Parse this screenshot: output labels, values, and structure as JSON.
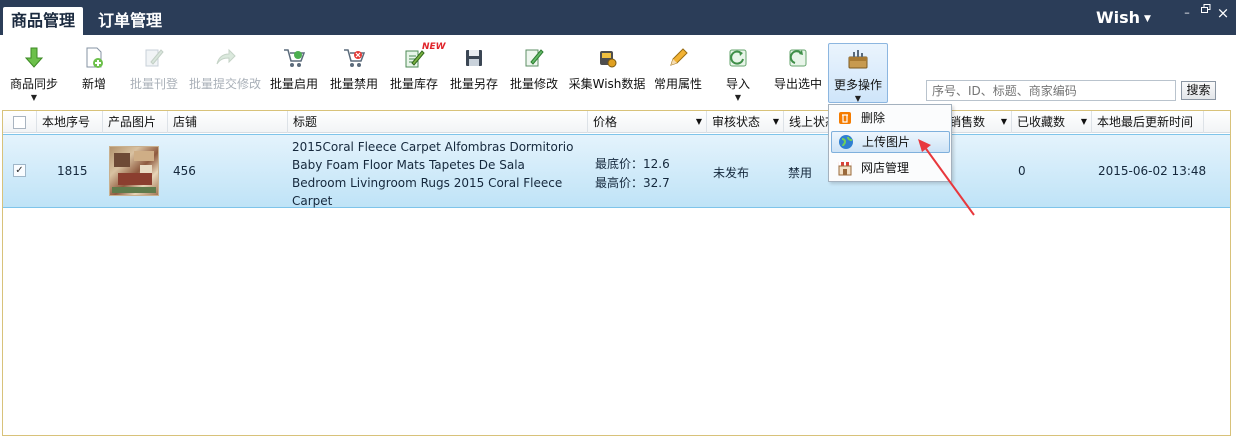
{
  "tabs": [
    {
      "label": "商品管理",
      "active": true
    },
    {
      "label": "订单管理",
      "active": false
    }
  ],
  "account": {
    "label": "Wish"
  },
  "window_controls": {
    "minimize": "–",
    "restore": "ᵖ",
    "close": "×"
  },
  "toolbar": {
    "buttons": [
      {
        "label": "商品同步",
        "icon": "sync-down-arrow-icon",
        "dropdown": true,
        "enabled": true
      },
      {
        "label": "新增",
        "icon": "new-document-icon",
        "enabled": true
      },
      {
        "label": "批量刊登",
        "icon": "publish-icon",
        "enabled": false
      },
      {
        "label": "批量提交修改",
        "icon": "submit-arrow-icon",
        "enabled": false
      },
      {
        "label": "批量启用",
        "icon": "cart-enable-icon",
        "enabled": true
      },
      {
        "label": "批量禁用",
        "icon": "cart-disable-icon",
        "enabled": true
      },
      {
        "label": "批量库存",
        "icon": "stock-edit-icon",
        "enabled": true,
        "badge": "NEW"
      },
      {
        "label": "批量另存",
        "icon": "floppy-disk-icon",
        "enabled": true
      },
      {
        "label": "批量修改",
        "icon": "edit-document-icon",
        "enabled": true
      },
      {
        "label": "采集Wish数据",
        "icon": "collect-data-icon",
        "enabled": true
      },
      {
        "label": "常用属性",
        "icon": "pencil-icon",
        "enabled": true
      },
      {
        "label": "导入",
        "icon": "import-icon",
        "enabled": true,
        "dropdown": true
      },
      {
        "label": "导出选中",
        "icon": "export-icon",
        "enabled": true
      },
      {
        "label": "更多操作",
        "icon": "toolbox-icon",
        "enabled": true,
        "dropdown": true,
        "active": true
      }
    ]
  },
  "search": {
    "placeholder": "序号、ID、标题、商家编码",
    "button": "搜索"
  },
  "grid": {
    "columns": [
      "本地序号",
      "产品图片",
      "店铺",
      "标题",
      "价格",
      "审核状态",
      "线上状态",
      "销售数",
      "已收藏数",
      "本地最后更新时间"
    ],
    "rows": [
      {
        "checked": true,
        "local_id": "1815",
        "store": "456",
        "title": "2015Coral Fleece Carpet Alfombras Dormitorio Baby Foam Floor Mats Tapetes De Sala Bedroom Livingroom Rugs 2015 Coral Fleece Carpet",
        "price_min": "最底价：12.6",
        "price_max": "最高价：32.7",
        "audit_status": "未发布",
        "online_status": "禁用",
        "favorites": "0",
        "updated": "2015-06-02 13:48"
      }
    ]
  },
  "more_menu": {
    "items": [
      {
        "label": "删除",
        "icon": "delete-icon"
      },
      {
        "label": "上传图片",
        "icon": "globe-upload-icon",
        "highlighted": true
      },
      {
        "label": "网店管理",
        "icon": "storefront-icon"
      }
    ]
  },
  "colors": {
    "titlebar": "#2b3d58",
    "row_selected": "#bfe3f7",
    "annotation_arrow": "#e8383d",
    "new_badge": "#e0242a"
  }
}
